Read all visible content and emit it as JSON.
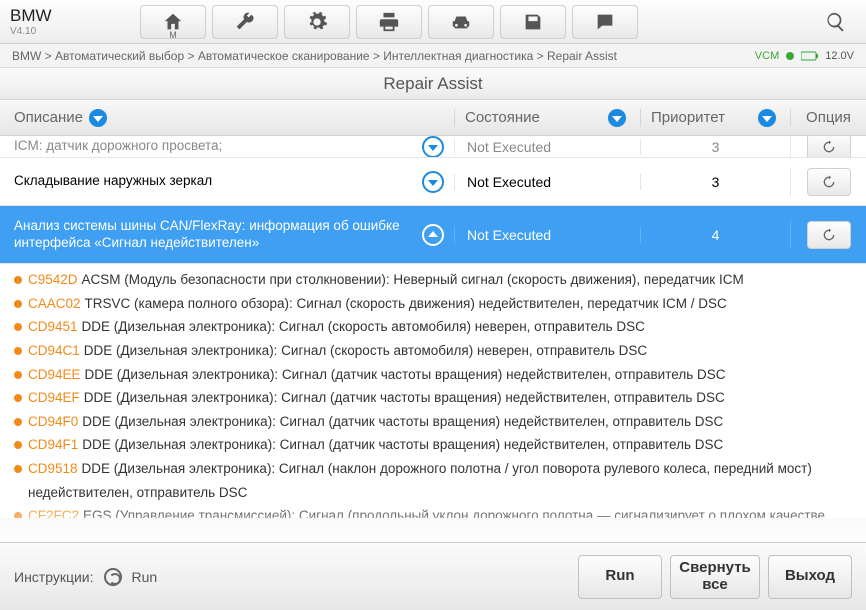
{
  "brand": {
    "name": "BMW",
    "version": "V4.10"
  },
  "toolbar_icons": [
    "home",
    "wrench",
    "gear",
    "print",
    "car",
    "save",
    "chat",
    "search"
  ],
  "breadcrumb": "BMW > Автоматический выбор > Автоматическое сканирование > Интеллектная диагностика > Repair Assist",
  "status": {
    "vcm": "VCM",
    "voltage": "12.0V"
  },
  "page_title": "Repair Assist",
  "headers": {
    "desc": "Описание",
    "state": "Состояние",
    "priority": "Приоритет",
    "option": "Опция"
  },
  "rows": [
    {
      "desc": "ICM: датчик дорожного просвета;",
      "state": "Not Executed",
      "priority": "3"
    },
    {
      "desc": "Складывание наружных зеркал",
      "state": "Not Executed",
      "priority": "3"
    },
    {
      "desc": "Анализ системы шины CAN/FlexRay: информация об ошибке интерфейса «Сигнал недействителен»",
      "state": "Not Executed",
      "priority": "4"
    }
  ],
  "details": [
    {
      "code": "C9542D",
      "text": "ACSM (Модуль безопасности при столкновении): Неверный сигнал (скорость движения), передатчик ICM"
    },
    {
      "code": "CAAC02",
      "text": "TRSVC (камера полного обзора): Сигнал (скорость движения) недействителен, передатчик ICM / DSC"
    },
    {
      "code": "CD9451",
      "text": "DDE (Дизельная электроника): Сигнал (скорость автомобиля) неверен, отправитель DSC"
    },
    {
      "code": "CD94C1",
      "text": "DDE (Дизельная электроника): Сигнал (скорость автомобиля) неверен, отправитель DSC"
    },
    {
      "code": "CD94EE",
      "text": "DDE (Дизельная электроника): Сигнал (датчик частоты вращения) недействителен, отправитель DSC"
    },
    {
      "code": "CD94EF",
      "text": "DDE (Дизельная электроника): Сигнал (датчик частоты вращения) недействителен, отправитель DSC"
    },
    {
      "code": "CD94F0",
      "text": "DDE (Дизельная электроника): Сигнал (датчик частоты вращения) недействителен, отправитель DSC"
    },
    {
      "code": "CD94F1",
      "text": "DDE (Дизельная электроника): Сигнал (датчик частоты вращения) недействителен, отправитель DSC"
    },
    {
      "code": "CD9518",
      "text": "DDE (Дизельная электроника): Сигнал (наклон дорожного полотна / угол поворота рулевого колеса, передний мост) недействителен, отправитель DSC"
    },
    {
      "code": "CF2FC2",
      "text": "EGS (Управление трансмиссией): Сигнал (продольный уклон дорожного полотна — сигнализирует о плохом качестве полезного сигнала) недействителен, отправитель ICM"
    }
  ],
  "legend": {
    "label": "Инструкции:",
    "run": "Run"
  },
  "buttons": {
    "run": "Run",
    "collapse": "Свернуть все",
    "exit": "Выход"
  }
}
